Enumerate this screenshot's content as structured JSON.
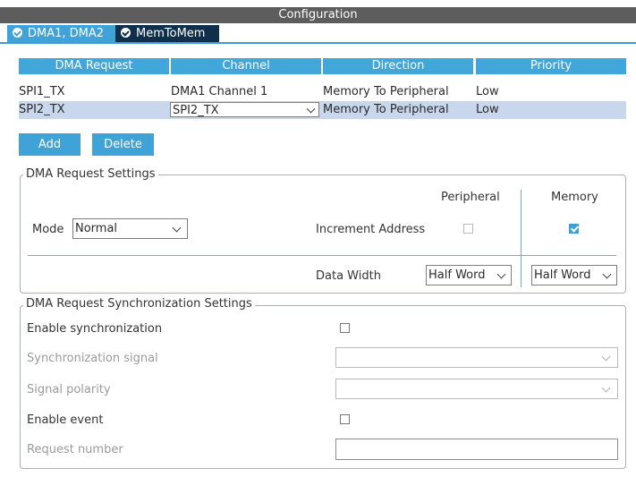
{
  "window": {
    "title": "Configuration"
  },
  "tabs": [
    {
      "label": "DMA1, DMA2"
    },
    {
      "label": "MemToMem"
    }
  ],
  "table": {
    "columns": [
      "DMA Request",
      "Channel",
      "Direction",
      "Priority"
    ],
    "rows": [
      {
        "request": "SPI1_TX",
        "channel": "DMA1 Channel 1",
        "direction": "Memory To Peripheral",
        "priority": "Low"
      },
      {
        "request": "SPI2_TX",
        "channel": "SPI2_TX",
        "direction": "Memory To Peripheral",
        "priority": "Low"
      }
    ]
  },
  "buttons": {
    "add": "Add",
    "delete": "Delete"
  },
  "request_settings": {
    "legend": "DMA Request Settings",
    "peripheral_header": "Peripheral",
    "memory_header": "Memory",
    "mode_label": "Mode",
    "mode_value": "Normal",
    "increment_label": "Increment Address",
    "increment_peripheral_checked": false,
    "increment_memory_checked": true,
    "data_width_label": "Data Width",
    "peripheral_width": "Half Word",
    "memory_width": "Half Word"
  },
  "sync_settings": {
    "legend": "DMA Request Synchronization Settings",
    "enable_sync_label": "Enable synchronization",
    "sync_signal_label": "Synchronization signal",
    "signal_polarity_label": "Signal polarity",
    "enable_event_label": "Enable event",
    "request_number_label": "Request number"
  },
  "colors": {
    "accent": "#40a3d8",
    "tab_active": "#0f2f4b",
    "selected_row": "#c9d7ec",
    "titlebar": "#5d5d5d"
  }
}
